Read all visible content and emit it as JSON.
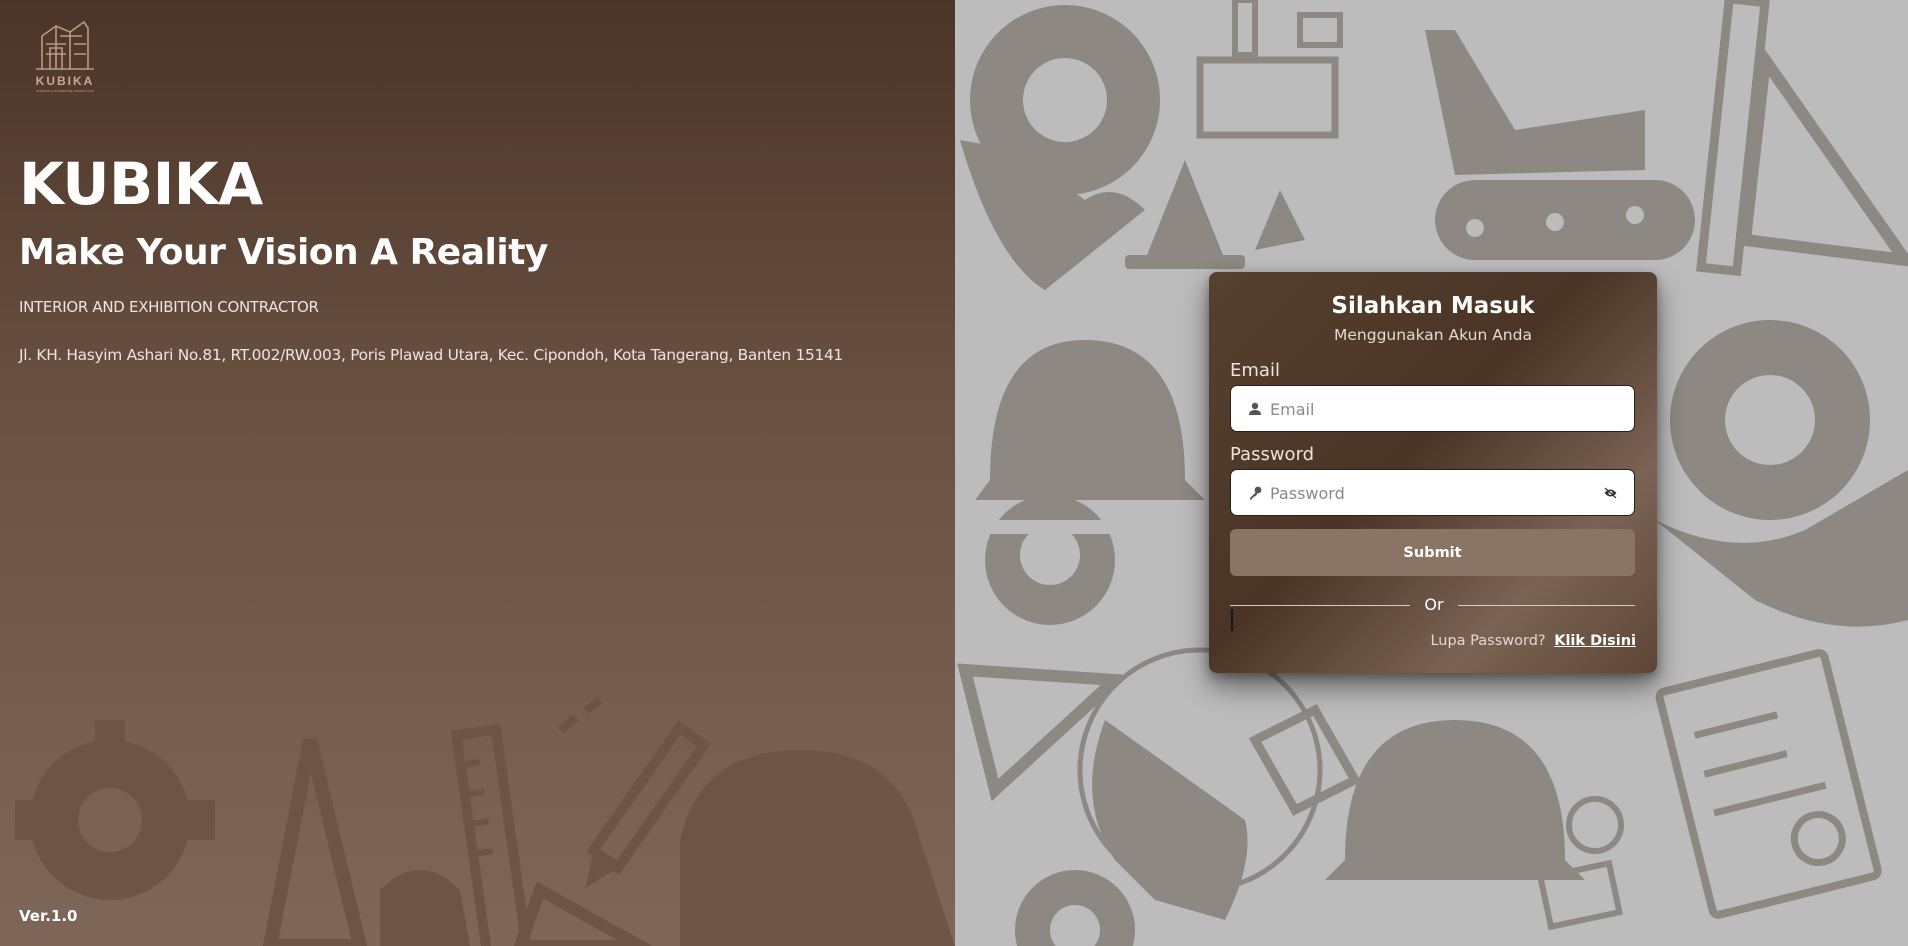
{
  "branding": {
    "logo_text": "KUBIKA",
    "logo_subtext": "INTERIOR & EXHIBITION CONTRACTOR",
    "title": "KUBIKA",
    "tagline": "Make Your Vision A Reality",
    "subtitle": "INTERIOR AND EXHIBITION CONTRACTOR",
    "address": "Jl. KH. Hasyim Ashari No.81, RT.002/RW.003, Poris Plawad Utara, Kec. Cipondoh, Kota Tangerang, Banten 15141",
    "version": "Ver.1.0"
  },
  "login": {
    "title": "Silahkan Masuk",
    "subtitle": "Menggunakan Akun Anda",
    "email_label": "Email",
    "email_placeholder": "Email",
    "email_value": "",
    "email_icon": "user-icon",
    "password_label": "Password",
    "password_placeholder": "Password",
    "password_value": "",
    "password_icon": "key-icon",
    "toggle_icon": "eye-icon",
    "submit_label": "Submit",
    "divider_text": "Or",
    "forgot_text": "Lupa Password?",
    "forgot_link": "Klik Disini"
  },
  "colors": {
    "left_panel_top": "#4b3528",
    "left_panel_bottom": "#7e6759",
    "right_panel_bg": "#bcbcbc",
    "card_bg": "#4a3425",
    "submit_bg": "#8a7465",
    "pattern_icon": "#8c8680"
  }
}
